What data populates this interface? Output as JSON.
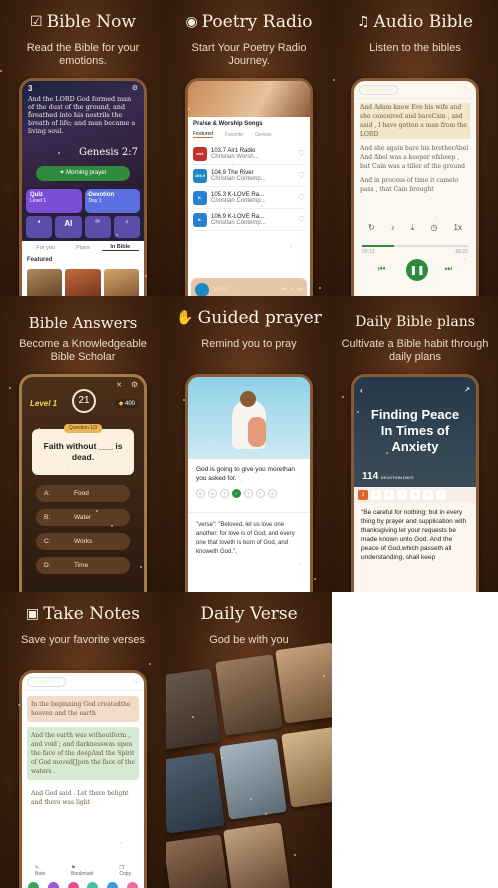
{
  "panels": [
    {
      "title": "Bible Now",
      "subtitle": "Read the Bible for your emotions.",
      "icon": "bible-check-icon"
    },
    {
      "title": "Poetry Radio",
      "subtitle": "Start Your Poetry Radio Journey.",
      "icon": "radio-icon"
    },
    {
      "title": "Audio Bible",
      "subtitle": "Listen to the bibles",
      "icon": "headphones-icon"
    },
    {
      "title": "Bible Answers",
      "subtitle": "Become a Knowledgeable Bible Scholar"
    },
    {
      "title": "Guided prayer",
      "subtitle": "Remind you to pray",
      "icon": "praying-hands-icon"
    },
    {
      "title": "Daily Bible plans",
      "subtitle": "Cultivate a Bible habit through daily plans"
    },
    {
      "title": "Take Notes",
      "subtitle": "Save your favorite verses",
      "icon": "note-icon"
    },
    {
      "title": "Daily Verse",
      "subtitle": "God be with you"
    }
  ],
  "bible_now": {
    "day": "3",
    "verse": "And the LORD God formed man of the dust of the ground, and breathed into his nostrils the breath of life; and man became a living soul.",
    "reference": "Genesis 2:7",
    "morning_prayer": "Morning prayer",
    "quiz": "Quiz",
    "quiz_level": "Level 1",
    "devotion": "Devotion",
    "devotion_day": "Day 1",
    "tabs": [
      "For you",
      "Plans",
      "In Bible"
    ],
    "featured": "Featured"
  },
  "poetry_radio": {
    "section": "Praise & Worship Songs",
    "tabs": [
      "Featured",
      "Favorite",
      "Genres"
    ],
    "stations": [
      {
        "name": "103.7 Air1 Radio",
        "sub": "Christian Worsh...",
        "color": "#c4302b",
        "logo": "air1"
      },
      {
        "name": "104.9 The River",
        "sub": "Christian Contemp...",
        "color": "#1e88c7",
        "logo": "104.9"
      },
      {
        "name": "105.3 K-LOVE Ra...",
        "sub": "Christian Contemp...",
        "color": "#2b7fd1",
        "logo": "K-LOVE"
      },
      {
        "name": "106.9 K-LOVE Ra...",
        "sub": "Christian Contemp...",
        "color": "#2b7fd1",
        "logo": "K-LOVE"
      }
    ],
    "now_playing": "104.9..."
  },
  "audio_bible": {
    "book": "Genesis 4",
    "font_btn": "Aa",
    "verses": [
      "And Adam knew Eve his wife and she conceived and bareCain , and said , I have gotten a man from the LORD",
      "And she again bare his brotherAbel And Abel was a keeper ofsheep , but Cain was a tiller of the ground",
      "And in process of time it cameto pass , that Cain brought"
    ],
    "time_start": "00:13",
    "time_end": "06:20",
    "speed": "1x",
    "progress": 0.3
  },
  "bible_answers": {
    "level": "Level 1",
    "timer": "21",
    "coins": "400",
    "question_label": "Question 1/3",
    "question": "Faith without ___ is dead.",
    "options": [
      {
        "key": "A:",
        "text": "Food"
      },
      {
        "key": "B:",
        "text": "Water"
      },
      {
        "key": "C:",
        "text": "Works"
      },
      {
        "key": "D:",
        "text": "Time"
      }
    ]
  },
  "guided_prayer": {
    "text": "God is going to give you morethan you asked for.",
    "days": [
      "S",
      "M",
      "T",
      "W",
      "T",
      "F",
      "S"
    ],
    "active_day": 3,
    "verse": "\"verse\": \"Beloved, let us love one another: for love is of God; and every one that loveth is born of God, and knoweth God.\","
  },
  "daily_plans": {
    "heading": "Finding Peace In Times of Anxiety",
    "count": "114",
    "count_label": "DEVOTION DAYS",
    "day_numbers": [
      "1",
      "2",
      "3",
      "4",
      "5",
      "6",
      "7"
    ],
    "verse": "\"Be careful for nothing; but in every thing by prayer and supplication with thanksgiving let your requests be made known unto God. And the peace of God,which passeth all understanding, shall keep"
  },
  "take_notes": {
    "book": "Genesis 1",
    "font_btn": "Aa",
    "verses": [
      {
        "text": "In the beginning God createdthe heaven and the earth",
        "color": "#f2dcc8"
      },
      {
        "text": "And the earth was withoutform , and void ; and darknesswas upon the face of the deepAnd the Spirit of God moved[Jpon the face of the waters .",
        "color": "#d5ead0"
      },
      {
        "text": "And God said . Let there belight and there was light",
        "color": "#ffffff"
      }
    ],
    "bottom": [
      "Note",
      "Bookmark",
      "Copy"
    ],
    "colors": [
      "#3aa55b",
      "#9b59d0",
      "#e84f8a",
      "#46c0a4",
      "#3a9be8",
      "#f06ca0"
    ]
  },
  "daily_verse": {
    "cards": [
      "#6b5a4e",
      "#9c7b5f",
      "#c9a57e",
      "#4e6070",
      "#7f8e9b",
      "#d7b98f",
      "#5a4a40",
      "#8c6a52",
      "#b0876a",
      "#3f4d5a",
      "#a9b6bf",
      "#c2a281"
    ]
  }
}
